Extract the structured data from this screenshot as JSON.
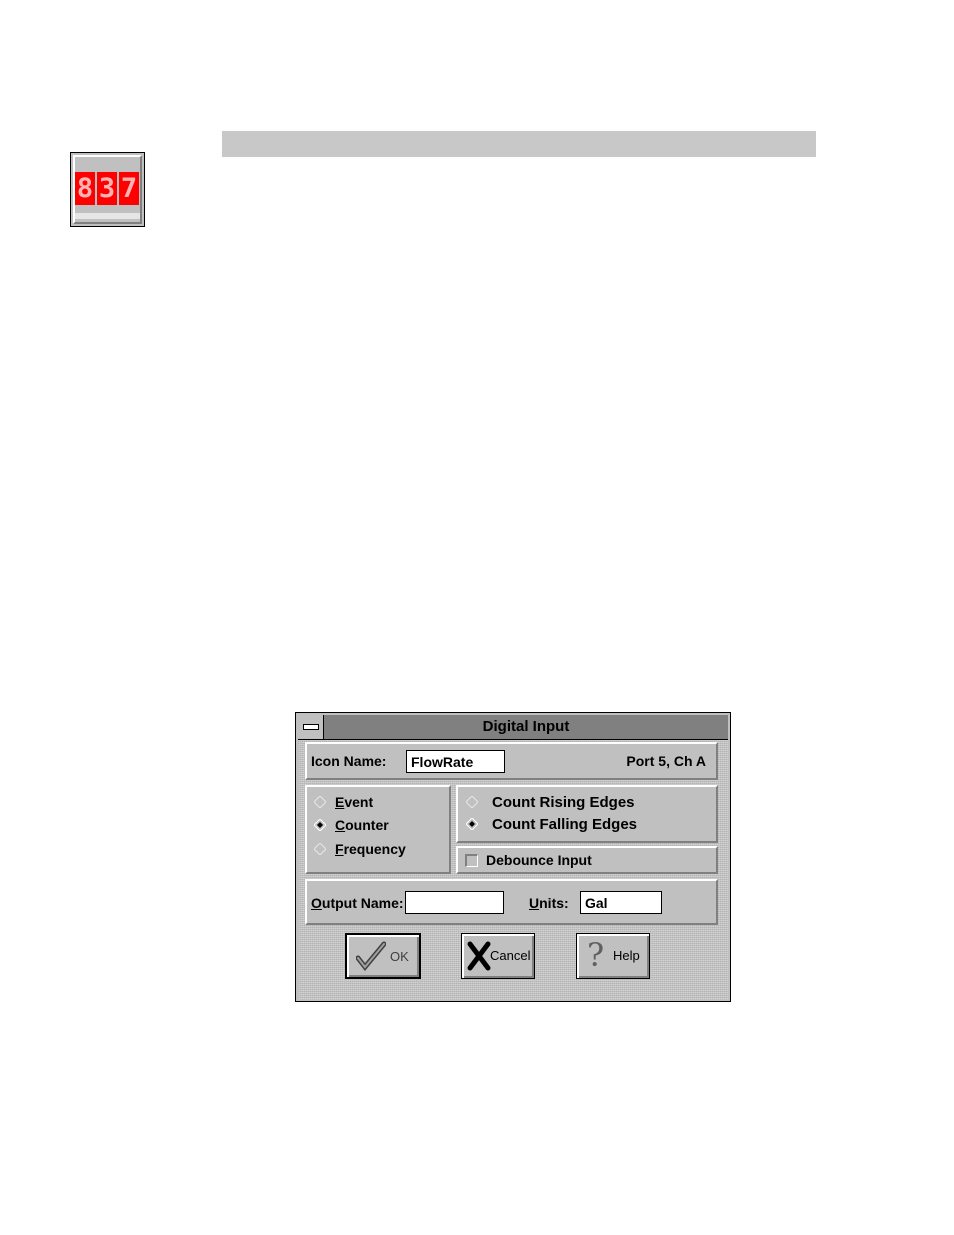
{
  "app_icon": {
    "name": "counter-display-icon",
    "digits": [
      "8",
      "3",
      "7"
    ]
  },
  "dialog": {
    "title": "Digital Input",
    "icon_name_label": "Icon Name:",
    "icon_name_value": "FlowRate",
    "port_info": "Port 5, Ch A",
    "mode_options": [
      {
        "label": "Event",
        "selected": false
      },
      {
        "label": "Counter",
        "selected": true
      },
      {
        "label": "Frequency",
        "selected": false
      }
    ],
    "edge_options": [
      {
        "label": "Count Rising Edges",
        "selected": false
      },
      {
        "label": "Count Falling Edges",
        "selected": true
      }
    ],
    "debounce_label": "Debounce Input",
    "debounce_checked": false,
    "output_name_label": "Output Name:",
    "output_name_value": "",
    "units_label": "Units:",
    "units_value": "Gal",
    "buttons": {
      "ok": "OK",
      "cancel": "Cancel",
      "help": "Help"
    }
  }
}
